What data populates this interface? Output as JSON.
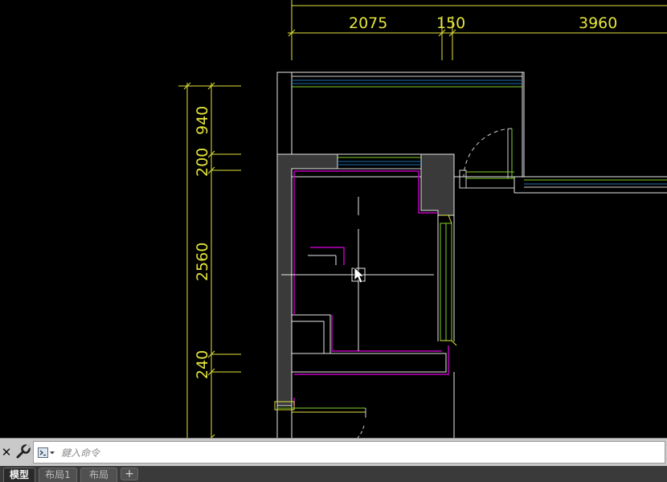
{
  "drawing": {
    "top_dimensions": [
      "2075",
      "150",
      "3960"
    ],
    "left_dimensions": [
      "940",
      "200",
      "2560",
      "240"
    ]
  },
  "icons": {
    "close": "close-icon",
    "settings": "wrench-icon",
    "prompt": "command-prompt-icon",
    "cursor": "arrow-cursor-icon"
  },
  "command_line": {
    "close_label": "✕",
    "placeholder": "鍵入命令",
    "value": ""
  },
  "layout_tabs": {
    "tabs": [
      "模型",
      "布局1",
      "布局"
    ],
    "active": "模型",
    "add_label": "+"
  },
  "colors": {
    "background": "#000000",
    "dimension": "#e3e33a",
    "wall_fill": "#3a3a3a",
    "finish_line": "#c000c0",
    "glass_line": "#1e6fb0",
    "frame_line": "#7fd02a"
  }
}
